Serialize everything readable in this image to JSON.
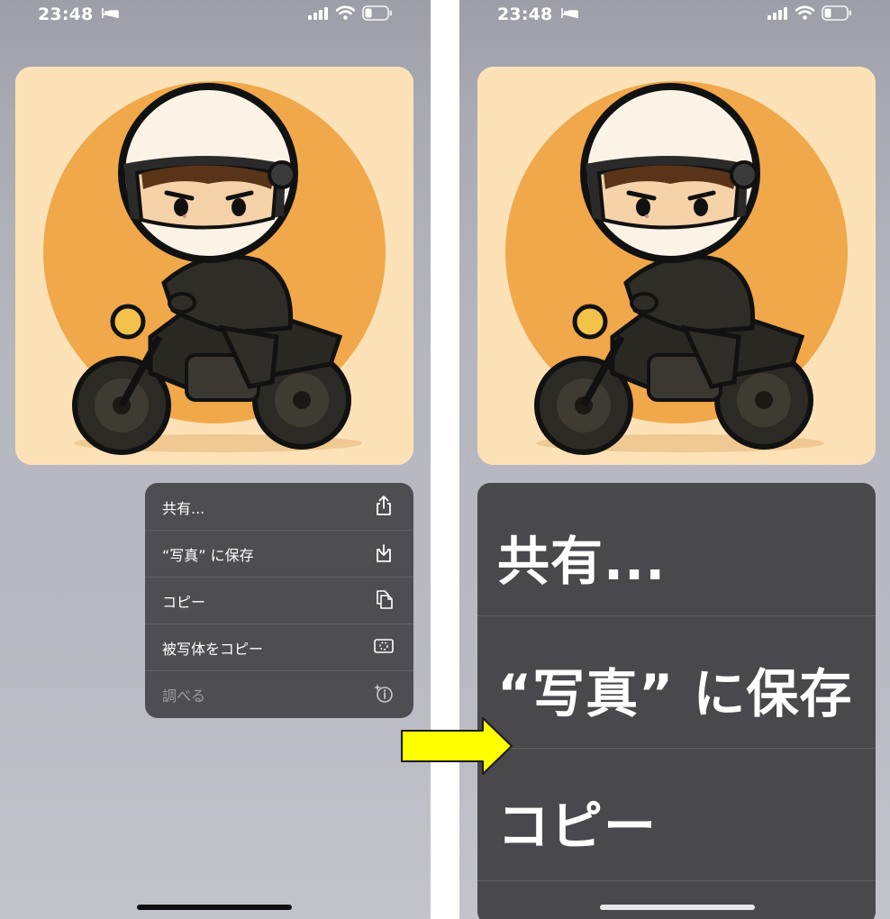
{
  "status_bar": {
    "time": "23:48"
  },
  "context_menu": {
    "items": [
      {
        "label": "共有...",
        "icon": "share-icon"
      },
      {
        "label": "“写真” に保存",
        "icon": "save-to-photos-icon"
      },
      {
        "label": "コピー",
        "icon": "copy-icon"
      },
      {
        "label": "被写体をコピー",
        "icon": "copy-subject-icon"
      },
      {
        "label": "調べる",
        "icon": "look-up-icon"
      }
    ]
  },
  "zoomed_menu": {
    "items": [
      {
        "label": "共有..."
      },
      {
        "label": "“写真” に保存"
      },
      {
        "label": "コピー"
      }
    ]
  },
  "colors": {
    "arrow": "#ffff00",
    "menu_bg": "#4a4a4e",
    "card_bg": "#fce0b4",
    "sun": "#f0a84a"
  }
}
